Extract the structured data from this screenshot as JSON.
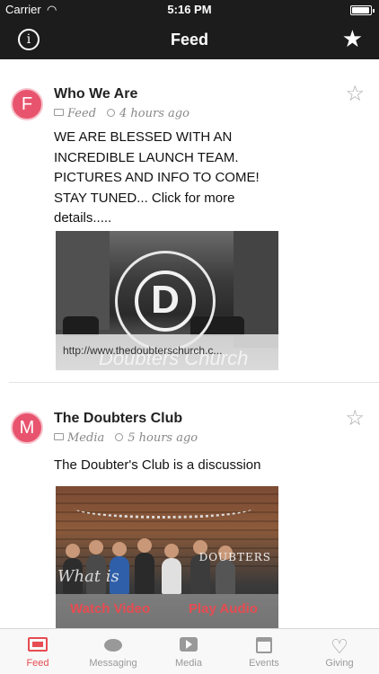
{
  "status_bar": {
    "carrier": "Carrier",
    "time": "5:16 PM"
  },
  "nav": {
    "title": "Feed",
    "info_glyph": "i",
    "left_icon": "info-icon",
    "right_icon": "star-icon"
  },
  "posts": [
    {
      "avatar_letter": "F",
      "title": "Who We Are",
      "category": "Feed",
      "time": "4 hours ago",
      "body": "WE ARE BLESSED WITH AN INCREDIBLE LAUNCH TEAM. PICTURES AND INFO TO COME! STAY TUNED... Click for more details.....",
      "link_url": "http://www.thedoubterschurch.c...",
      "watermark": "Doubters Church"
    },
    {
      "avatar_letter": "M",
      "title": "The Doubters Club",
      "category": "Media",
      "time": "5 hours ago",
      "body": "The Doubter's Club is a discussion",
      "watch_label": "Watch Video",
      "play_label": "Play Audio",
      "overlay_left": "What is",
      "overlay_logo": "DOUBTERS"
    }
  ],
  "tabs": [
    {
      "label": "Feed",
      "icon": "newspaper-icon",
      "active": true
    },
    {
      "label": "Messaging",
      "icon": "chat-icon",
      "active": false
    },
    {
      "label": "Media",
      "icon": "play-icon",
      "active": false
    },
    {
      "label": "Events",
      "icon": "calendar-icon",
      "active": false
    },
    {
      "label": "Giving",
      "icon": "heart-icon",
      "active": false
    }
  ],
  "colors": {
    "accent": "#e74c52",
    "avatar": "#e8546e",
    "bar": "#1c1c1c"
  }
}
